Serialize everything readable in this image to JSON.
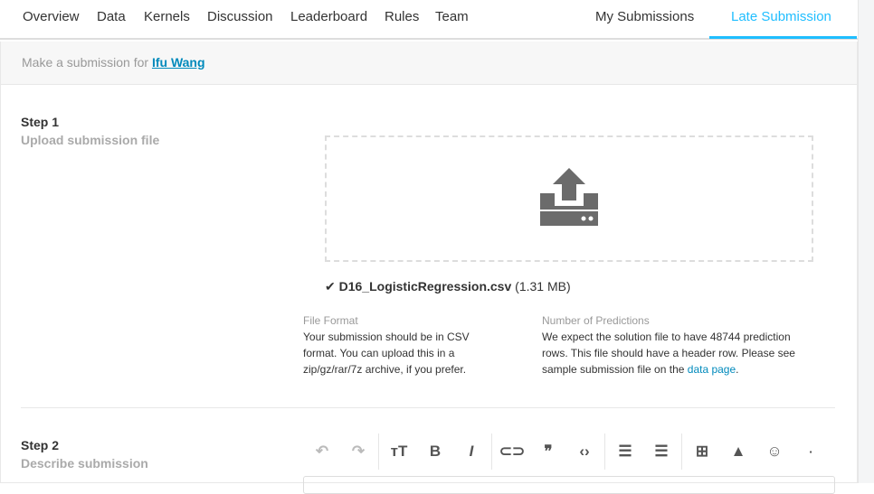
{
  "nav": {
    "tabs": [
      "Overview",
      "Data",
      "Kernels",
      "Discussion",
      "Leaderboard",
      "Rules",
      "Team"
    ],
    "my_submissions": "My Submissions",
    "late_submission": "Late Submission"
  },
  "header": {
    "prefix": "Make a submission for",
    "user": "Ifu Wang"
  },
  "step1": {
    "title": "Step 1",
    "subtitle": "Upload submission file",
    "file_name": "D16_LogisticRegression.csv",
    "file_size": "(1.31 MB)",
    "file_format": {
      "label": "File Format",
      "text": "Your submission should be in CSV format. You can upload this in a zip/gz/rar/7z archive, if you prefer."
    },
    "predictions": {
      "label": "Number of Predictions",
      "text": "We expect the solution file to have 48744 prediction rows. This file should have a header row. Please see sample submission file on the",
      "link": "data page",
      "end": "."
    }
  },
  "step2": {
    "title": "Step 2",
    "subtitle": "Describe submission"
  },
  "toolbar": {
    "undo": "↶",
    "redo": "↷",
    "heading": "тT",
    "bold": "B",
    "italic": "I",
    "link": "⊂⊃",
    "quote": "❞",
    "code": "‹›",
    "ol": "☰",
    "ul": "☰",
    "table": "⊞",
    "image": "▲",
    "emoji": "☺",
    "more": "▪"
  }
}
